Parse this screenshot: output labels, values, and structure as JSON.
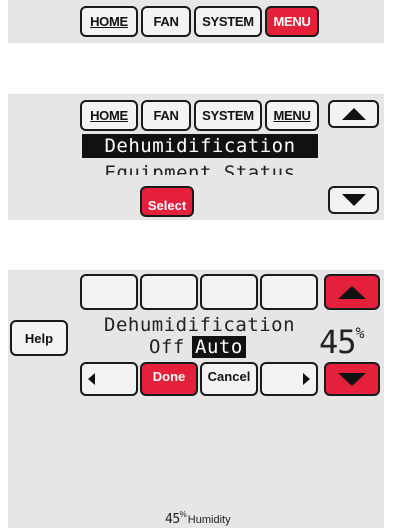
{
  "screen1": {
    "tabs": [
      "HOME",
      "FAN",
      "SYSTEM",
      "MENU"
    ]
  },
  "screen2": {
    "tabs": [
      "HOME",
      "FAN",
      "SYSTEM",
      "MENU"
    ],
    "list": {
      "selected_item": "Dehumidification",
      "next_item": "Equipment Status"
    },
    "select_label": "Select"
  },
  "screen3": {
    "help_label": "Help",
    "setting_title": "Dehumidification",
    "option_off": "Off",
    "option_auto": "Auto",
    "done_label": "Done",
    "cancel_label": "Cancel",
    "humidity_value": "45",
    "humidity_unit": "%",
    "footer_value": "45",
    "footer_unit": "%",
    "footer_label": "Humidity"
  },
  "colors": {
    "accent_red": "#e5203a",
    "panel_gray": "#e6e6e6"
  },
  "icons": [
    "up-arrow-icon",
    "down-arrow-icon",
    "left-arrow-icon",
    "right-arrow-icon"
  ]
}
